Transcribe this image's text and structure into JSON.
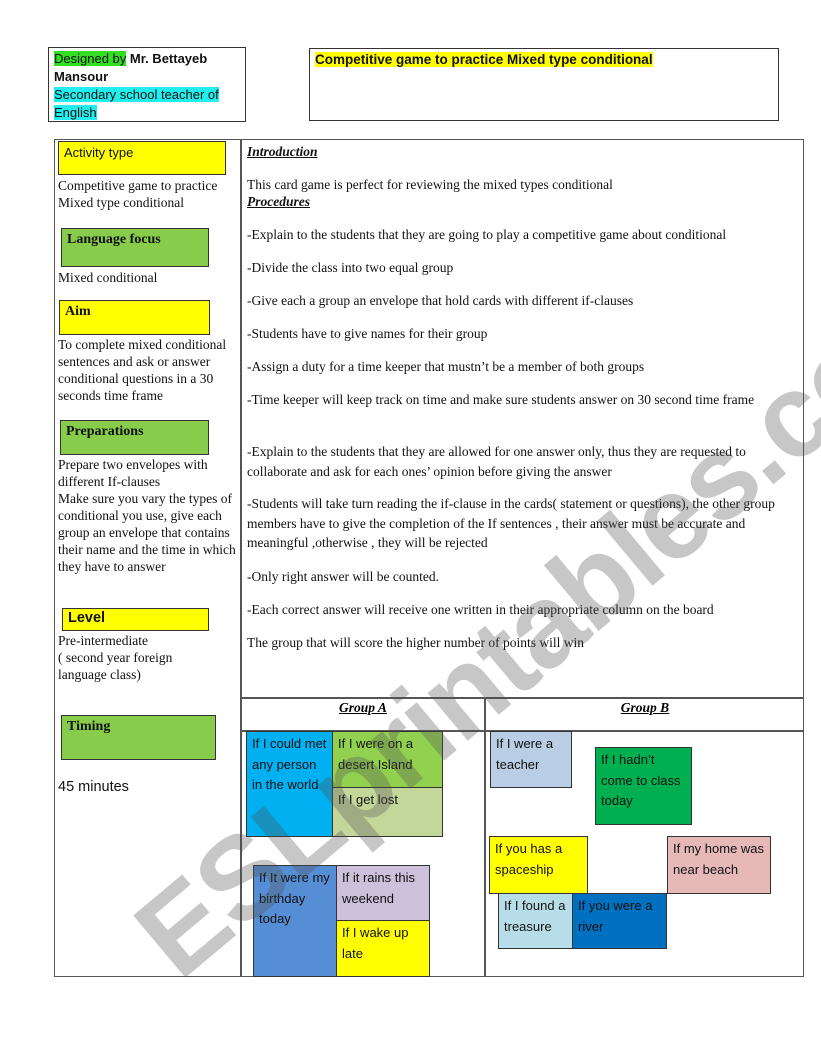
{
  "header": {
    "author": {
      "designed_by_label": "Designed by",
      "name": "Mr. Bettayeb Mansour",
      "role": "Secondary school teacher of English"
    },
    "title": "Competitive game to practice Mixed type conditional"
  },
  "sidebar": {
    "activity_type": {
      "label": "Activity type",
      "text": "Competitive game to practice Mixed type conditional"
    },
    "language_focus": {
      "label": "Language focus",
      "text": "Mixed conditional"
    },
    "aim": {
      "label": "Aim",
      "text": "To complete mixed conditional sentences and ask or answer conditional questions in a 30 seconds time frame"
    },
    "preparations": {
      "label": "Preparations",
      "text1": "Prepare two envelopes with different If-clauses",
      "text2": "Make sure you vary the types of conditional you use, give each group an envelope that contains their name and the time in which they have to answer"
    },
    "level": {
      "label": "Level",
      "text1": "Pre-intermediate",
      "text2": "( second year foreign language class)"
    },
    "timing": {
      "label": "Timing",
      "text": "45 minutes"
    }
  },
  "main": {
    "introduction": {
      "heading": "Introduction",
      "text": "This card game is perfect for reviewing the mixed types conditional"
    },
    "procedures": {
      "heading": "Procedures",
      "steps": [
        "-Explain to the students that they are going to play a competitive game about conditional",
        "-Divide the class into two equal group",
        "-Give each a group an envelope that hold cards with different if-clauses",
        "-Students have to give names for their group",
        "-Assign a duty for a time keeper that mustn’t be a member of both groups",
        "-Time keeper will keep track on time and make sure students answer on 30 second time frame",
        "-Explain to the students that they are allowed for one answer only, thus they are requested to collaborate and ask for each ones’ opinion before giving the answer",
        "-Students will take turn reading the if-clause in the cards( statement or questions), the other group members have to give the completion of the If sentences  , their answer must be accurate and meaningful ,otherwise , they will be rejected",
        "-Only right answer will be counted.",
        "-Each correct answer will receive one written in their appropriate column on the board",
        "The group that will score the higher number of points  will win"
      ]
    }
  },
  "groups": {
    "group_a": {
      "heading": "Group A",
      "cards": [
        {
          "text": "If I could met any person in the world",
          "color": "#00b0f0"
        },
        {
          "text": "If I were on a desert Island",
          "color": "#92d050"
        },
        {
          "text": "If I get lost",
          "color": "#c4d79b"
        },
        {
          "text": "If It were my birthday today",
          "color": "#558ed5"
        },
        {
          "text": "If it rains this weekend",
          "color": "#ccc0da"
        },
        {
          "text": "If I wake up late",
          "color": "#ffff00"
        }
      ]
    },
    "group_b": {
      "heading": "Group B",
      "cards": [
        {
          "text": "If I were a teacher",
          "color": "#b9cde5"
        },
        {
          "text": "If I hadn’t come to class today",
          "color": "#00b050"
        },
        {
          "text": "If you has a spaceship",
          "color": "#ffff00"
        },
        {
          "text": "If my home was near beach",
          "color": "#e6b9b8"
        },
        {
          "text": "If I found a treasure",
          "color": "#b7dee8"
        },
        {
          "text": "If you were a river",
          "color": "#0070c0"
        }
      ]
    }
  },
  "watermark": "ESLprintables.com"
}
